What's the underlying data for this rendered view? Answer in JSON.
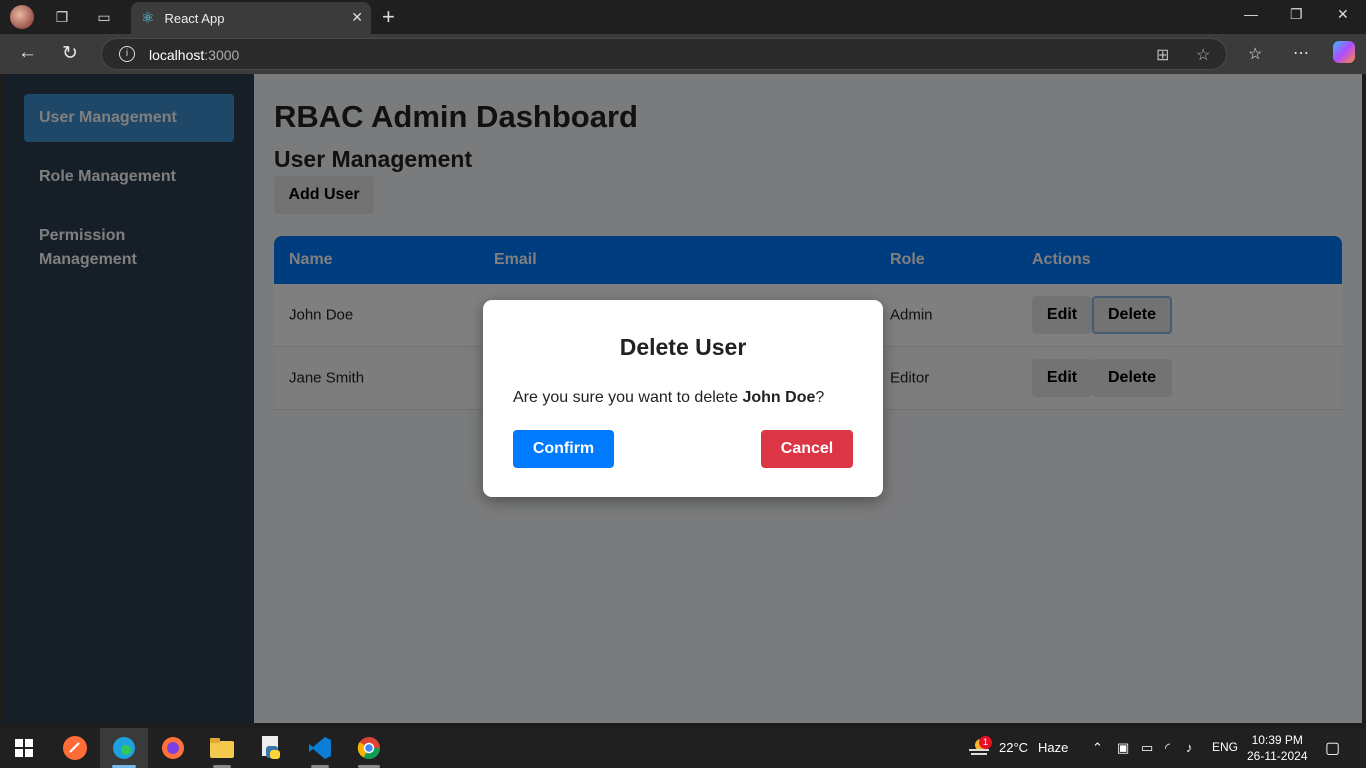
{
  "browser": {
    "tab_title": "React App",
    "url_host": "localhost",
    "url_port": ":3000"
  },
  "sidebar": {
    "items": [
      {
        "label": "User Management"
      },
      {
        "label": "Role Management"
      },
      {
        "label": "Permission Management"
      }
    ]
  },
  "main": {
    "title": "RBAC Admin Dashboard",
    "subtitle": "User Management",
    "add_button": "Add User"
  },
  "table": {
    "headers": [
      "Name",
      "Email",
      "Role",
      "Actions"
    ],
    "rows": [
      {
        "name": "John Doe",
        "role": "Admin",
        "edit": "Edit",
        "delete": "Delete"
      },
      {
        "name": "Jane Smith",
        "role": "Editor",
        "edit": "Edit",
        "delete": "Delete"
      }
    ]
  },
  "modal": {
    "title": "Delete User",
    "message_prefix": "Are you sure you want to delete ",
    "message_name": "John Doe",
    "message_suffix": "?",
    "confirm": "Confirm",
    "cancel": "Cancel"
  },
  "taskbar": {
    "weather_temp": "22°C",
    "weather_desc": "Haze",
    "weather_badge": "1",
    "language": "ENG",
    "time": "10:39 PM",
    "date": "26-11-2024"
  },
  "colors": {
    "sidebar_bg": "#2c3e50",
    "sidebar_active": "#3e8ed0",
    "table_header": "#007bff",
    "confirm": "#007bff",
    "cancel": "#dc3545"
  }
}
